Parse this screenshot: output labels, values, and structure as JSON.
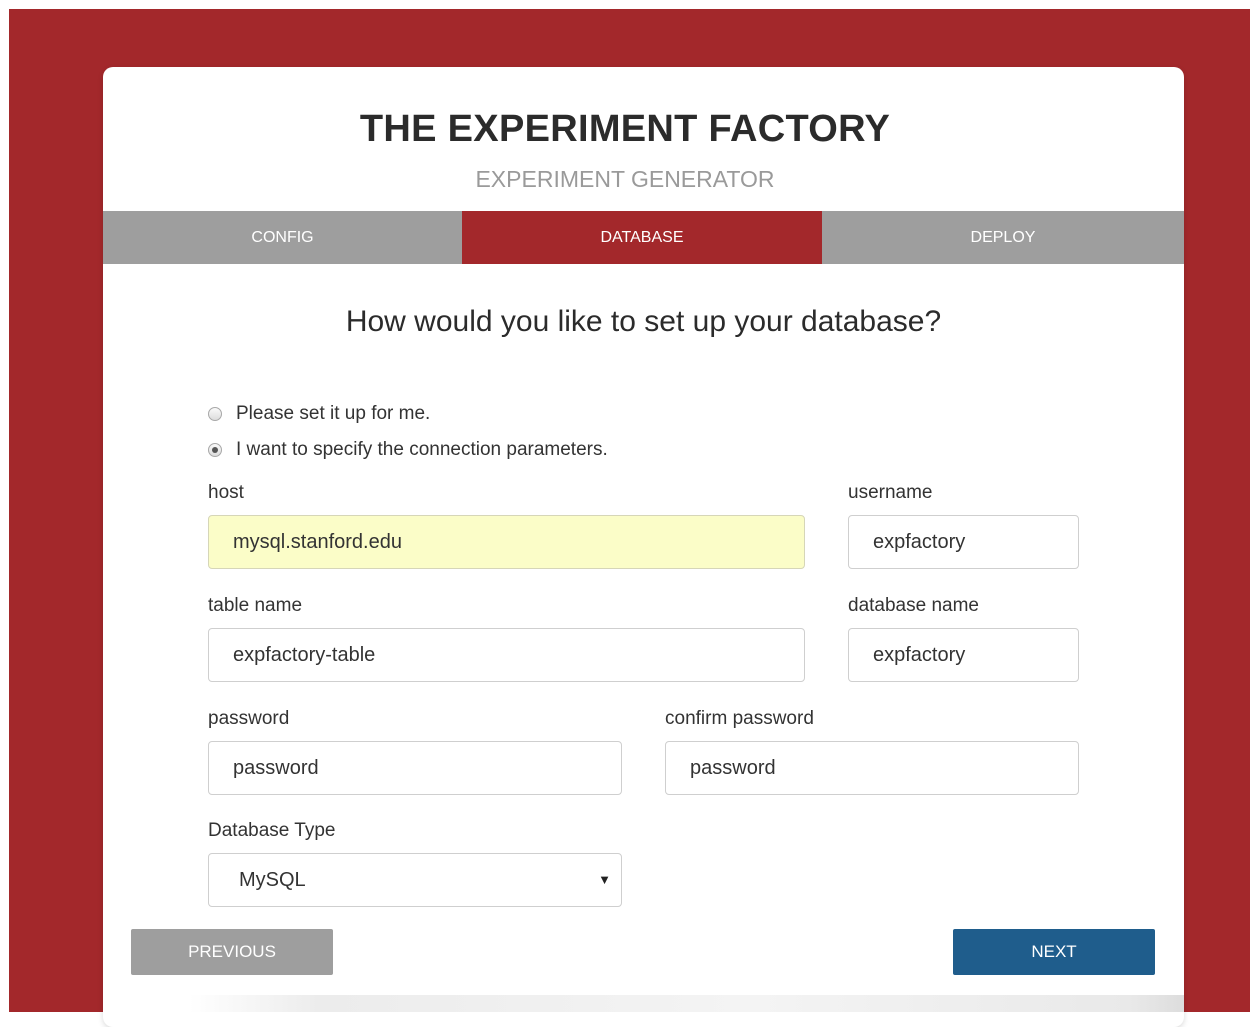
{
  "app": {
    "title": "THE EXPERIMENT FACTORY",
    "subtitle": "EXPERIMENT GENERATOR"
  },
  "tabs": [
    {
      "label": "CONFIG",
      "active": false
    },
    {
      "label": "DATABASE",
      "active": true
    },
    {
      "label": "DEPLOY",
      "active": false
    }
  ],
  "form": {
    "question": "How would you like to set up your database?",
    "options": [
      {
        "label": "Please set it up for me.",
        "selected": false
      },
      {
        "label": "I want to specify the connection parameters.",
        "selected": true
      }
    ],
    "host": {
      "label": "host",
      "value": "mysql.stanford.edu"
    },
    "username": {
      "label": "username",
      "value": "expfactory"
    },
    "table_name": {
      "label": "table name",
      "value": "expfactory-table"
    },
    "database_name": {
      "label": "database name",
      "value": "expfactory"
    },
    "password": {
      "label": "password",
      "value": "password"
    },
    "confirm_password": {
      "label": "confirm password",
      "value": "password"
    },
    "database_type": {
      "label": "Database Type",
      "selected": "MySQL"
    }
  },
  "buttons": {
    "previous": "PREVIOUS",
    "next": "NEXT"
  },
  "colors": {
    "brand_red": "#a3282b",
    "tab_gray": "#9e9e9e",
    "next_blue": "#1f5d8c",
    "autofill_yellow": "#fbfdc8"
  }
}
